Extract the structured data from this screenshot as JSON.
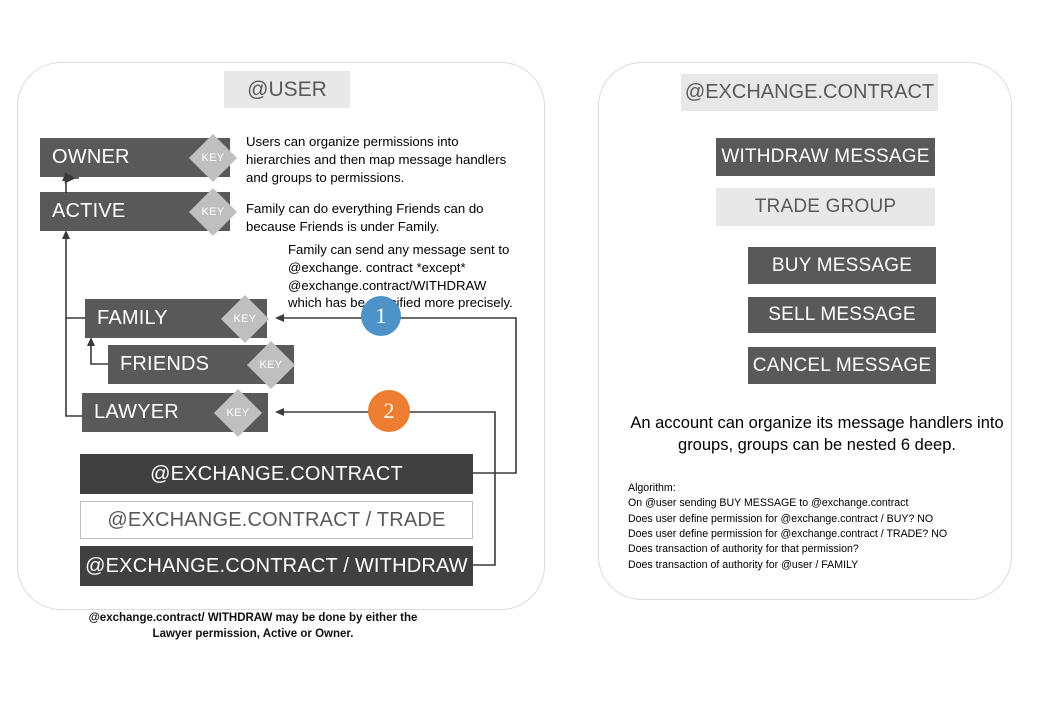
{
  "colors": {
    "bar_dark": "#595959",
    "bar_darker": "#404040",
    "bar_light": "#e8e8e8",
    "key_diamond": "#bfbfbf",
    "badge_1": "#4d93c8",
    "badge_2": "#ed7d31",
    "card_border": "#dcdcdc",
    "wire": "#3a3a3a"
  },
  "left_panel": {
    "header": "@USER",
    "permissions": [
      {
        "name": "OWNER",
        "key_label": "KEY"
      },
      {
        "name": "ACTIVE",
        "key_label": "KEY"
      },
      {
        "name": "FAMILY",
        "key_label": "KEY"
      },
      {
        "name": "FRIENDS",
        "key_label": "KEY"
      },
      {
        "name": "LAWYER",
        "key_label": "KEY"
      }
    ],
    "contracts": [
      {
        "name": "@EXCHANGE.CONTRACT"
      },
      {
        "name": "@EXCHANGE.CONTRACT / TRADE"
      },
      {
        "name": "@EXCHANGE.CONTRACT / WITHDRAW"
      }
    ],
    "notes": {
      "note1": "Users can organize permissions into hierarchies and then map message handlers and groups to permissions.",
      "note2": "Family can do everything  Friends can do because Friends is under Family.",
      "note3": "Family can send any message sent to @exchange. contract  *except* @exchange.contract/WITHDRAW which has be specified more precisely."
    },
    "badges": [
      {
        "number": "1"
      },
      {
        "number": "2"
      }
    ],
    "caption": "@exchange.contract/ WITHDRAW may be done by either the Lawyer permission, Active or Owner."
  },
  "right_panel": {
    "header": "@EXCHANGE.CONTRACT",
    "items": [
      {
        "name": "WITHDRAW MESSAGE",
        "style": "dark"
      },
      {
        "name": "TRADE GROUP",
        "style": "light"
      },
      {
        "name": "BUY MESSAGE",
        "style": "dark"
      },
      {
        "name": "SELL MESSAGE",
        "style": "dark"
      },
      {
        "name": "CANCEL MESSAGE",
        "style": "dark"
      }
    ],
    "note": "An account can organize its message handlers into groups, groups can be nested 6 deep.",
    "algorithm": "Algorithm:\nOn @user sending BUY MESSAGE to @exchange.contract\nDoes user define permission  for @exchange.contract  / BUY? NO\nDoes user define permission  for @exchange.contract  / TRADE? NO\nDoes transaction  of authority  for that permission?\nDoes transaction  of authority  for @user / FAMILY"
  }
}
